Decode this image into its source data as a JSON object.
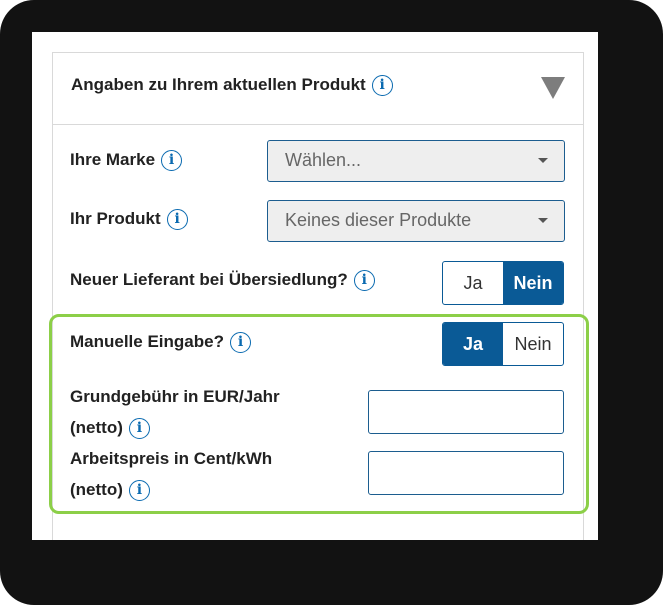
{
  "section": {
    "title": "Angaben zu Ihrem aktuellen Produkt",
    "info_glyph": "i"
  },
  "fields": {
    "brand": {
      "label": "Ihre Marke",
      "value": "Wählen..."
    },
    "product": {
      "label": "Ihr Produkt",
      "value": "Keines dieser Produkte"
    },
    "new_supplier": {
      "label": "Neuer Lieferant bei Übersiedlung?",
      "yes": "Ja",
      "no": "Nein",
      "selected": "Nein"
    },
    "manual_entry": {
      "label": "Manuelle Eingabe?",
      "yes": "Ja",
      "no": "Nein",
      "selected": "Ja"
    },
    "base_fee": {
      "label_line1": "Grundgebühr in EUR/Jahr",
      "label_line2": "(netto)",
      "value": ""
    },
    "energy_price": {
      "label_line1": "Arbeitspreis in Cent/kWh",
      "label_line2": "(netto)",
      "value": ""
    }
  },
  "colors": {
    "accent": "#0a5a96",
    "highlight_border": "#8ccf48",
    "frame": "#121212"
  }
}
